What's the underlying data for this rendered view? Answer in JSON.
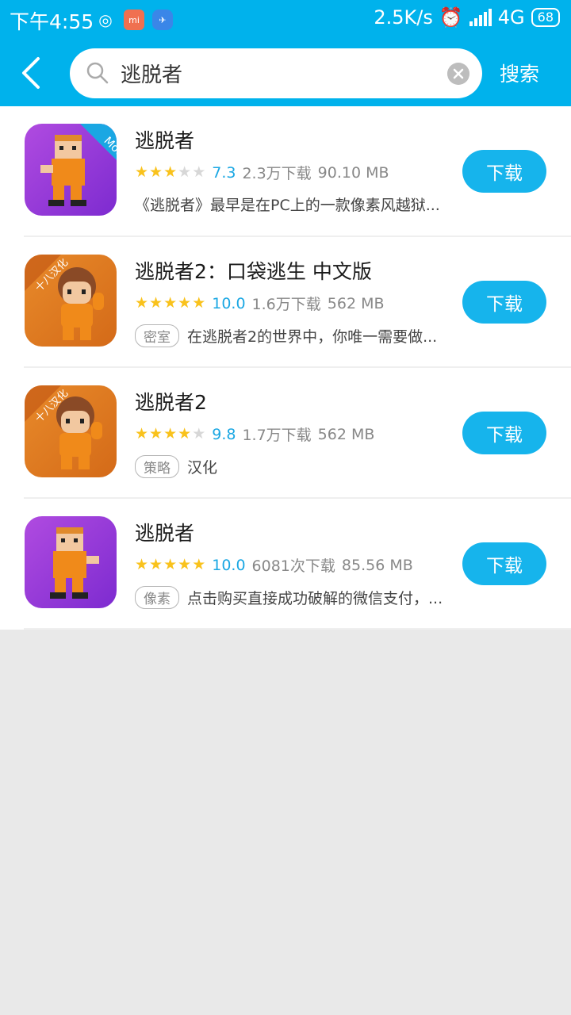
{
  "status_bar": {
    "time": "下午4:55",
    "net_speed": "2.5K/s",
    "network": "4G",
    "battery": "68"
  },
  "search": {
    "query": "逃脱者",
    "button_label": "搜索"
  },
  "colors": {
    "accent": "#00b2ec",
    "button": "#16b4ec",
    "star": "#f9c21c",
    "rating": "#1aa7e3"
  },
  "results": [
    {
      "title": "逃脱者",
      "stars_on": 3,
      "rating": "7.3",
      "downloads": "2.3万下载",
      "size": "90.10 MB",
      "tag": "",
      "description": "《逃脱者》最早是在PC上的一款像素风越狱...",
      "badge": "Mod",
      "download_label": "下载"
    },
    {
      "title": "逃脱者2：口袋逃生 中文版",
      "stars_on": 5,
      "rating": "10.0",
      "downloads": "1.6万下载",
      "size": "562 MB",
      "tag": "密室",
      "description": "在逃脱者2的世界中，你唯一需要做...",
      "badge": "十八汉化",
      "download_label": "下载"
    },
    {
      "title": "逃脱者2",
      "stars_on": 4,
      "rating": "9.8",
      "downloads": "1.7万下载",
      "size": "562 MB",
      "tag": "策略",
      "description": "汉化",
      "badge": "十八汉化",
      "download_label": "下载"
    },
    {
      "title": "逃脱者",
      "stars_on": 5,
      "rating": "10.0",
      "downloads": "6081次下载",
      "size": "85.56 MB",
      "tag": "像素",
      "description": "点击购买直接成功破解的微信支付，...",
      "badge": "",
      "download_label": "下载"
    }
  ]
}
